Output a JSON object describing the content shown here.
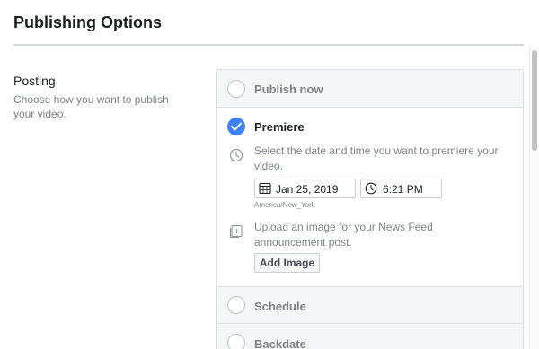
{
  "header": {
    "title": "Publishing Options"
  },
  "posting": {
    "label": "Posting",
    "description": "Choose how you want to publish your video."
  },
  "options": {
    "publish_now": {
      "label": "Publish now",
      "selected": false
    },
    "premiere": {
      "label": "Premiere",
      "selected": true,
      "date_description": "Select the date and time you want to premiere your video.",
      "date_value": "Jan 25, 2019",
      "time_value": "6:21 PM",
      "timezone": "America/New_York",
      "upload_description": "Upload an image for your News Feed announcement post.",
      "add_image_label": "Add Image"
    },
    "schedule": {
      "label": "Schedule",
      "selected": false
    },
    "backdate": {
      "label": "Backdate",
      "selected": false
    }
  },
  "colors": {
    "accent": "#4080ff",
    "muted_text": "#7f8285",
    "border": "#dddfe2",
    "row_background": "#f5f6f7"
  },
  "icons": [
    "checkmark-icon",
    "clock-icon",
    "calendar-icon",
    "image-upload-icon"
  ]
}
